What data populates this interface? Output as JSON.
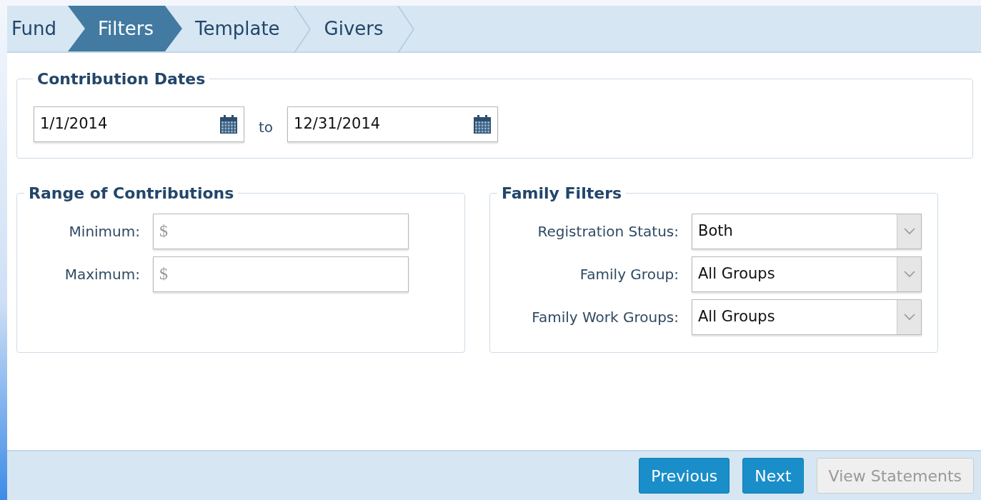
{
  "steps": [
    {
      "label": "Fund",
      "selected": false
    },
    {
      "label": "Filters",
      "selected": true
    },
    {
      "label": "Template",
      "selected": false
    },
    {
      "label": "Givers",
      "selected": false
    }
  ],
  "contribution_dates": {
    "legend": "Contribution Dates",
    "from": {
      "value": "1/1/2014"
    },
    "separator": "to",
    "to": {
      "value": "12/31/2014"
    }
  },
  "range_of_contributions": {
    "legend": "Range of Contributions",
    "fields": [
      {
        "label": "Minimum:",
        "placeholder": "$"
      },
      {
        "label": "Maximum:",
        "placeholder": "$"
      }
    ]
  },
  "family_filters": {
    "legend": "Family Filters",
    "fields": [
      {
        "label": "Registration Status:",
        "value": "Both"
      },
      {
        "label": "Family Group:",
        "value": "All Groups"
      },
      {
        "label": "Family Work Groups:",
        "value": "All Groups"
      }
    ]
  },
  "buttons": [
    {
      "label": "Previous",
      "disabled": false
    },
    {
      "label": "Next",
      "disabled": false
    },
    {
      "label": "View Statements",
      "disabled": true
    }
  ]
}
